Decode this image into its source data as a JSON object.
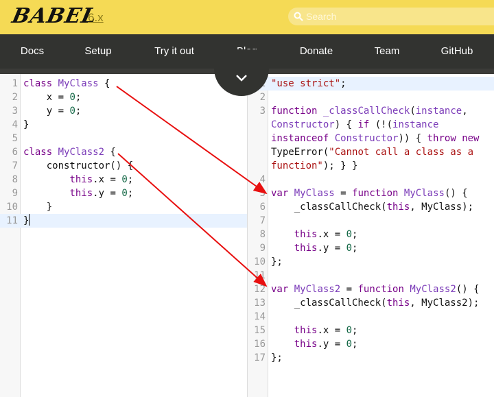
{
  "header": {
    "logo": "BABEL",
    "version": "6.x",
    "search_placeholder": "Search",
    "brand_color": "#f5da55"
  },
  "nav": {
    "items": [
      "Docs",
      "Setup",
      "Try it out",
      "Blog",
      "Donate",
      "Team",
      "GitHub"
    ]
  },
  "input_editor": {
    "line_numbers": [
      "1",
      "2",
      "3",
      "4",
      "5",
      "6",
      "7",
      "8",
      "9",
      "10",
      "11"
    ],
    "lines": [
      "class MyClass {",
      "    x = 0;",
      "    y = 0;",
      "}",
      "",
      "class MyClass2 {",
      "    constructor() {",
      "        this.x = 0;",
      "        this.y = 0;",
      "    }",
      "}"
    ]
  },
  "output_editor": {
    "line_numbers": [
      "1",
      "2",
      "3",
      "",
      "",
      "",
      "",
      "4",
      "5",
      "6",
      "7",
      "8",
      "9",
      "10",
      "11",
      "12",
      "13",
      "14",
      "15",
      "16",
      "17"
    ],
    "lines": [
      "\"use strict\";",
      "",
      "function _classCallCheck(instance,",
      "Constructor) { if (!(instance",
      "instanceof Constructor)) { throw new",
      "TypeError(\"Cannot call a class as a",
      "function\"); } }",
      "",
      "var MyClass = function MyClass() {",
      "    _classCallCheck(this, MyClass);",
      "",
      "    this.x = 0;",
      "    this.y = 0;",
      "};",
      "",
      "var MyClass2 = function MyClass2() {",
      "    _classCallCheck(this, MyClass2);",
      "",
      "    this.x = 0;",
      "    this.y = 0;",
      "};"
    ]
  },
  "annotation_color": "#e81010"
}
